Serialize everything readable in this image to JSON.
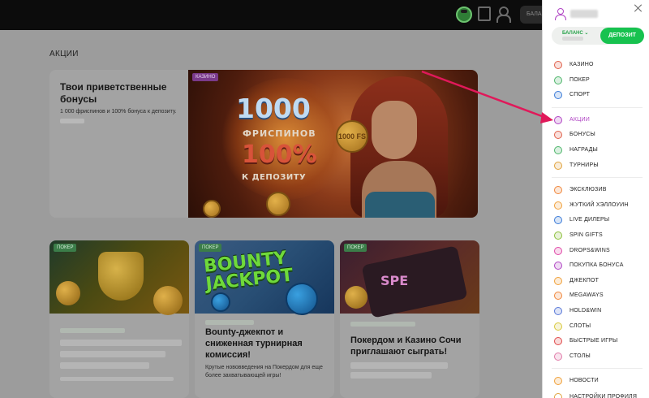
{
  "topbar": {
    "balance_label": "БАЛАНС"
  },
  "main": {
    "page_title": "АКЦИИ",
    "hero": {
      "title": "Твои приветственные бонусы",
      "subtitle": "1 000 фриспинов и 100% бонуса к депозиту.",
      "tag": "КАЗИНО",
      "banner": {
        "big_number": "1000",
        "freespins": "ФРИСПИНОВ",
        "percent": "100%",
        "to_deposit": "К ДЕПОЗИТУ",
        "coin_text": "1000 FS"
      }
    },
    "cards": [
      {
        "tag": "ПОКЕР",
        "title": "",
        "desc": ""
      },
      {
        "tag": "ПОКЕР",
        "banner_text": "BOUNTY JACKPOT",
        "title": "Bounty-джекпот и сниженная турнирная комиссия!",
        "desc": "Крутые нововведения на Покердом для еще более захватывающей игры!"
      },
      {
        "tag": "ПОКЕР",
        "banner_text": "SPE",
        "title": "Покердом и Казино Сочи приглашают сыграть!",
        "desc": ""
      }
    ]
  },
  "panel": {
    "balance_label": "БАЛАНС ⌄",
    "deposit_button": "ДЕПОЗИТ",
    "menu_groups": [
      [
        {
          "label": "КАЗИНО",
          "icon": "casino-icon",
          "color": "#e0604a"
        },
        {
          "label": "ПОКЕР",
          "icon": "poker-icon",
          "color": "#4db56a"
        },
        {
          "label": "СПОРТ",
          "icon": "sport-icon",
          "color": "#3b7bd8"
        }
      ],
      [
        {
          "label": "АКЦИИ",
          "icon": "star-icon",
          "color": "#b044c4",
          "active": true
        },
        {
          "label": "БОНУСЫ",
          "icon": "gift-icon",
          "color": "#e0604a"
        },
        {
          "label": "НАГРАДЫ",
          "icon": "medal-icon",
          "color": "#4db56a"
        },
        {
          "label": "ТУРНИРЫ",
          "icon": "cup-icon",
          "color": "#e0a23b"
        }
      ],
      [
        {
          "label": "ЭКСКЛЮЗИВ",
          "icon": "exclusive-icon",
          "color": "#f0863a"
        },
        {
          "label": "ЖУТКИЙ ХЭЛЛОУИН",
          "icon": "pumpkin-icon",
          "color": "#f0a03a"
        },
        {
          "label": "LIVE ДИЛЕРЫ",
          "icon": "live-icon",
          "color": "#3b7bd8"
        },
        {
          "label": "SPIN GIFTS",
          "icon": "spin-gifts-icon",
          "color": "#8cbf3a"
        },
        {
          "label": "DROPS&WINS",
          "icon": "drops-icon",
          "color": "#e04aa8"
        },
        {
          "label": "ПОКУПКА БОНУСА",
          "icon": "buy-bonus-icon",
          "color": "#b044c4"
        },
        {
          "label": "ДЖЕКПОТ",
          "icon": "jackpot-icon",
          "color": "#f0a03a"
        },
        {
          "label": "MEGAWAYS",
          "icon": "megaways-icon",
          "color": "#f0863a"
        },
        {
          "label": "HOLD&WIN",
          "icon": "hold-win-icon",
          "color": "#5a7ad8"
        },
        {
          "label": "СЛОТЫ",
          "icon": "slots-icon",
          "color": "#d8c83a"
        },
        {
          "label": "БЫСТРЫЕ ИГРЫ",
          "icon": "fast-games-icon",
          "color": "#e04a4a"
        },
        {
          "label": "СТОЛЫ",
          "icon": "tables-icon",
          "color": "#e07aa8"
        }
      ],
      [
        {
          "label": "НОВОСТИ",
          "icon": "news-icon",
          "color": "#f0a03a"
        }
      ]
    ],
    "partial_bottom_label": "НАСТРОЙКИ ПРОФИЛЯ"
  },
  "annotation": {
    "arrow_color": "#e0195a"
  }
}
